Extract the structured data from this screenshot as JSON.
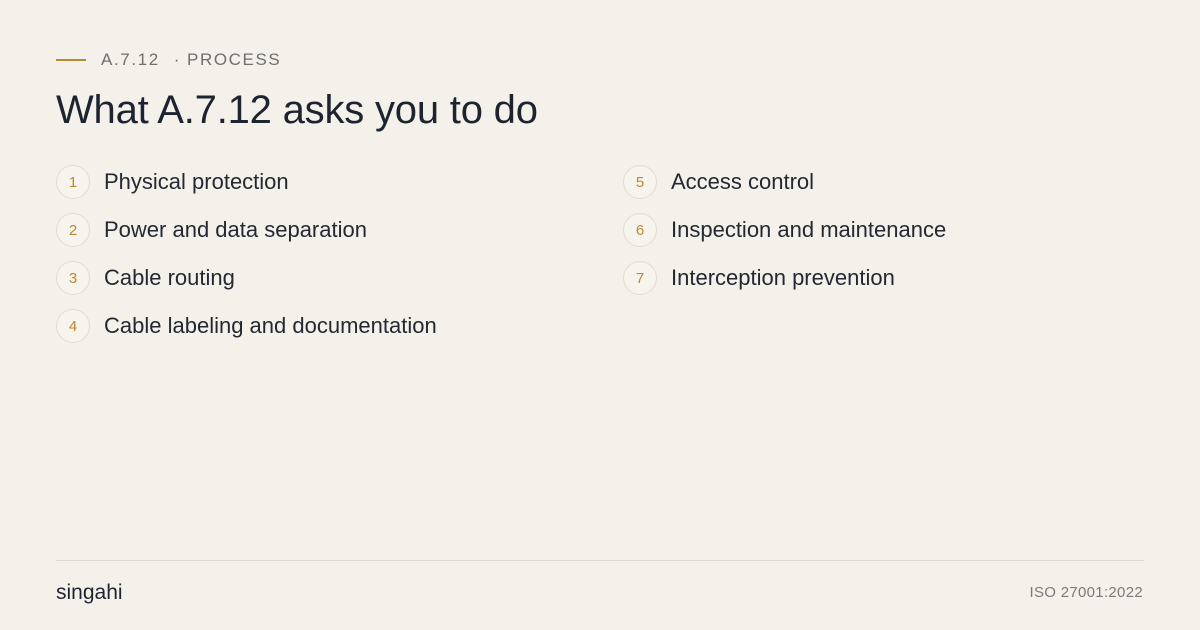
{
  "header": {
    "control_id": "A.7.12",
    "separator": "·",
    "category": "PROCESS",
    "title": "What A.7.12  asks you to do"
  },
  "steps_left": [
    {
      "number": "1",
      "label": "Physical protection"
    },
    {
      "number": "2",
      "label": "Power and data separation"
    },
    {
      "number": "3",
      "label": "Cable routing"
    },
    {
      "number": "4",
      "label": "Cable labeling and documentation"
    }
  ],
  "steps_right": [
    {
      "number": "5",
      "label": "Access control"
    },
    {
      "number": "6",
      "label": "Inspection and maintenance"
    },
    {
      "number": "7",
      "label": "Interception  prevention"
    }
  ],
  "footer": {
    "brand": "singahi",
    "standard": "ISO 27001:2022"
  },
  "colors": {
    "background": "#f4f1eb",
    "accent": "#b9892f",
    "text": "#1f2530"
  }
}
